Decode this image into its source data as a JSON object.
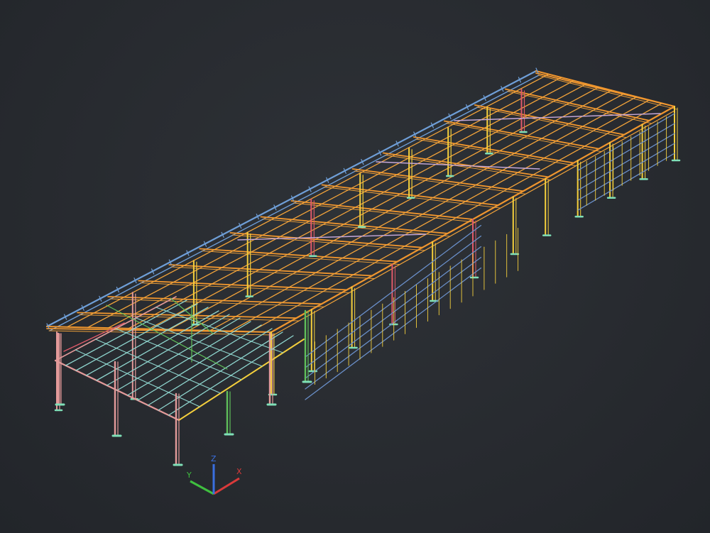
{
  "viewport": {
    "background": "#2b2e33"
  },
  "model": {
    "colors": {
      "roof_beam": "#f0962e",
      "purlin": "#f2a33a",
      "column_yellow": "#f4cf3c",
      "column_red": "#e05a6a",
      "column_pink": "#e39a9a",
      "column_green": "#5fbf5a",
      "ridge_blue": "#6f9fd8",
      "wall_girt_blue": "#6a8fc9",
      "floor_cyan": "#8fd6cf",
      "base_plate": "#7fe0b8"
    }
  },
  "ucs_icon": {
    "x_label": "X",
    "y_label": "Y",
    "z_label": "Z",
    "x_color": "#d93a3a",
    "y_color": "#3fbf3f",
    "z_color": "#3a6fe0"
  }
}
